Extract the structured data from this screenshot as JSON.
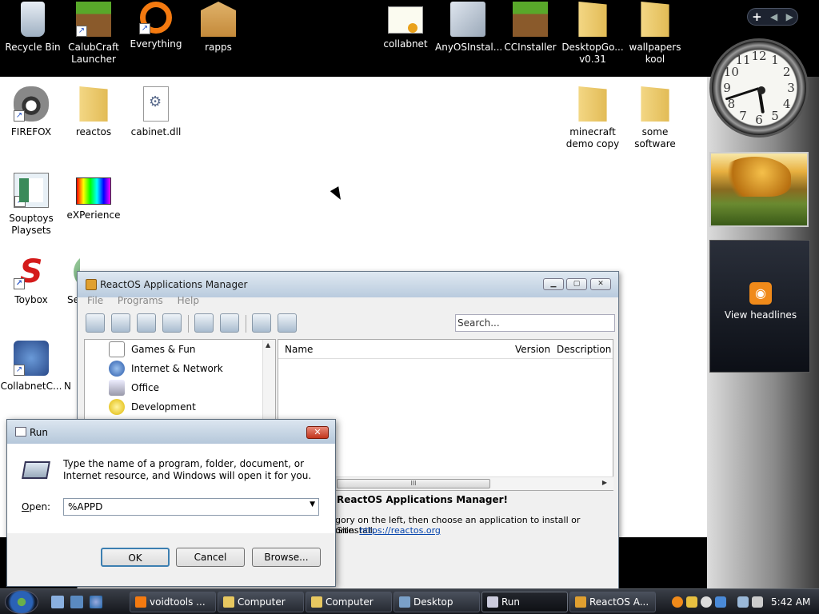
{
  "desktop": {
    "icons": [
      {
        "label": "Recycle Bin"
      },
      {
        "label": "CalubCraft Launcher"
      },
      {
        "label": "Everything"
      },
      {
        "label": "rapps"
      },
      {
        "label": "collabnet"
      },
      {
        "label": "AnyOSInstal..."
      },
      {
        "label": "CCInstaller"
      },
      {
        "label": "DesktopGo... v0.31"
      },
      {
        "label": "wallpapers kool"
      },
      {
        "label": "FIREFOX"
      },
      {
        "label": "reactos"
      },
      {
        "label": "cabinet.dll"
      },
      {
        "label": "minecraft demo copy"
      },
      {
        "label": "some software"
      },
      {
        "label": "Souptoys Playsets"
      },
      {
        "label": "eXPerience"
      },
      {
        "label": "Toybox"
      },
      {
        "label": "Se"
      },
      {
        "label": "CollabnetC..."
      },
      {
        "label": "N"
      }
    ]
  },
  "sidebar": {
    "add_label": "+",
    "prev_label": "◀",
    "next_label": "▶",
    "clock_numbers": [
      "12",
      "1",
      "2",
      "3",
      "4",
      "5",
      "6",
      "7",
      "8",
      "9",
      "10",
      "11"
    ],
    "clock_hour": 5,
    "clock_minute": 42,
    "feed_label": "View headlines",
    "feed_icon": "rss-icon"
  },
  "rapps": {
    "title": "ReactOS Applications Manager",
    "minimize": "▁",
    "maximize": "▢",
    "close": "✕",
    "menu": [
      "File",
      "Programs",
      "Help"
    ],
    "search_placeholder": "Search...",
    "categories": [
      "Games & Fun",
      "Internet & Network",
      "Office",
      "Development"
    ],
    "columns": [
      "Name",
      "Version",
      "Description"
    ],
    "scroll_thumb": "III",
    "scroll_arrow": "▶",
    "info_heading": "ReactOS Applications Manager!",
    "info_text": "gory on the left, then choose an application to install or uninstall.",
    "info_site_label": "Site:",
    "info_site_url": "https://reactos.org"
  },
  "run": {
    "title": "Run",
    "close": "✕",
    "description": "Type the name of a program, folder, document, or Internet resource, and Windows will open it for you.",
    "open_label_pre": "",
    "open_label_u": "O",
    "open_label_post": "pen:",
    "input_value": "%APPD",
    "dropdown_arrow": "▼",
    "ok": "OK",
    "cancel": "Cancel",
    "browse": "Browse..."
  },
  "taskbar": {
    "tasks": [
      {
        "label": "voidtools ..."
      },
      {
        "label": "Computer"
      },
      {
        "label": "Computer"
      },
      {
        "label": "Desktop"
      },
      {
        "label": "Run"
      },
      {
        "label": "ReactOS A..."
      }
    ],
    "time": "5:42 AM"
  },
  "colors": {
    "accent": "#3c7fb1",
    "link": "#0645ad",
    "close_red": "#c2351c",
    "rss_orange": "#f08a1a"
  }
}
